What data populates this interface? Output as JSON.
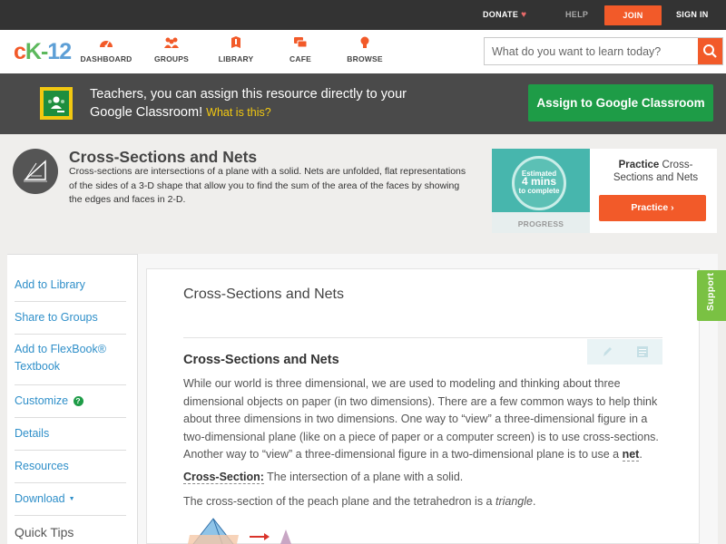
{
  "topbar": {
    "donate": "DONATE",
    "help": "HELP",
    "join": "JOIN",
    "signin": "SIGN IN"
  },
  "nav": {
    "logo_c": "c",
    "logo_k": "K",
    "logo_dash": "-",
    "logo_12": "12",
    "items": [
      {
        "label": "DASHBOARD",
        "icon": "dashboard-icon"
      },
      {
        "label": "GROUPS",
        "icon": "groups-icon"
      },
      {
        "label": "LIBRARY",
        "icon": "library-icon"
      },
      {
        "label": "CAFE",
        "icon": "cafe-icon"
      },
      {
        "label": "BROWSE",
        "icon": "browse-icon"
      }
    ],
    "search_placeholder": "What do you want to learn today?"
  },
  "google_banner": {
    "text": "Teachers, you can assign this resource directly to your Google Classroom!",
    "link": "What is this?",
    "button": "Assign to Google Classroom"
  },
  "concept": {
    "title": "Cross-Sections and Nets",
    "description": "Cross-sections are intersections of a plane with a solid. Nets are unfolded, flat representations of the sides of a 3-D shape that allow you to find the sum of the area of the faces by showing the edges and faces in 2-D."
  },
  "practice": {
    "estimated": "Estimated",
    "mins": "4 mins",
    "to_complete": "to complete",
    "progress": "PROGRESS",
    "label_bold": "Practice",
    "label_rest": "Cross-Sections and Nets",
    "button": "Practice"
  },
  "sidebar": {
    "items": [
      "Add to Library",
      "Share to Groups",
      "Add to FlexBook® Textbook",
      "Customize",
      "Details",
      "Resources",
      "Download",
      "Quick Tips"
    ]
  },
  "content": {
    "title": "Cross-Sections and Nets",
    "subtitle": "Cross-Sections and Nets",
    "para_main": "While our world is three dimensional, we are used to modeling and thinking about three dimensional objects on paper (in two dimensions). There are a few common ways to help think about three dimensions in two dimensions. One way to “view” a three-dimensional figure in a two-dimensional plane (like on a piece of paper or a computer screen) is to use cross-sections. Another way to “view” a three-dimensional figure in a two-dimensional plane is to use a",
    "para_net": "net",
    "para_end": ".",
    "def_term": "Cross-Section:",
    "def_text": "The intersection of a plane with a solid.",
    "tri_text": "The cross-section of the peach plane and the tetrahedron is a",
    "tri_word": "triangle",
    "tri_end": "."
  },
  "support": "Support",
  "colors": {
    "orange": "#f25a29",
    "green": "#1e9c47",
    "link_blue": "#2f8fc9",
    "support_green": "#7ac143"
  }
}
